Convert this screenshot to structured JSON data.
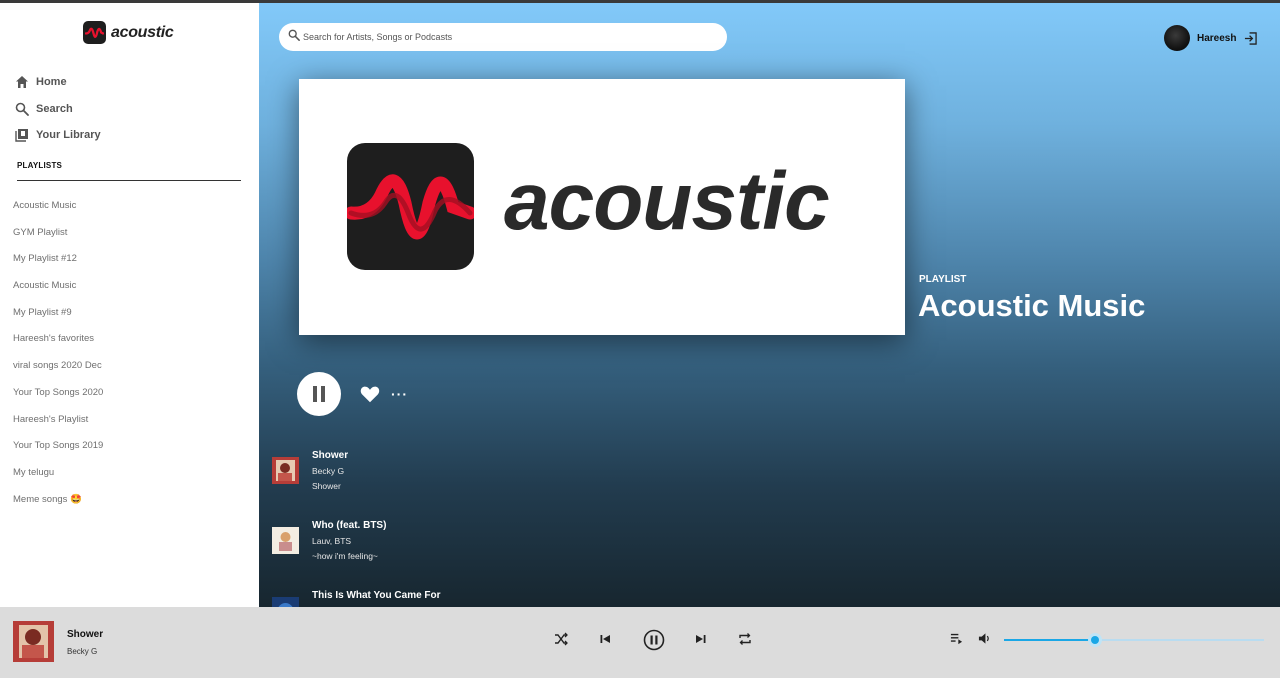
{
  "brand": {
    "name": "acoustic"
  },
  "nav": [
    {
      "label": "Home",
      "icon": "home-icon"
    },
    {
      "label": "Search",
      "icon": "search-icon"
    },
    {
      "label": "Your Library",
      "icon": "library-icon"
    }
  ],
  "playlists_heading": "PLAYLISTS",
  "playlists": [
    "Acoustic Music",
    "GYM Playlist",
    "My Playlist #12",
    "Acoustic Music",
    "My Playlist #9",
    "Hareesh's favorites",
    "viral songs 2020 Dec",
    "Your Top Songs 2020",
    "Hareesh's Playlist",
    "Your Top Songs 2019",
    "My telugu",
    "Meme songs 🤩"
  ],
  "search": {
    "placeholder": "Search for Artists, Songs or Podcasts"
  },
  "user": {
    "name": "Hareesh"
  },
  "cover": {
    "wordmark": "acoustic"
  },
  "playlist": {
    "type_label": "PLAYLIST",
    "title": "Acoustic Music"
  },
  "tracks": [
    {
      "title": "Shower",
      "artist": "Becky G",
      "album": "Shower"
    },
    {
      "title": "Who (feat. BTS)",
      "artist": "Lauv, BTS",
      "album": "~how i'm feeling~"
    },
    {
      "title": "This Is What You Came For",
      "artist": "",
      "album": ""
    }
  ],
  "now_playing": {
    "title": "Shower",
    "artist": "Becky G"
  },
  "volume": {
    "level": 0.35
  },
  "colors": {
    "accent": "#1aa7e6",
    "brand_red": "#e8112d",
    "sidebar_bg": "#ffffff",
    "player_bg": "#dcdcdc"
  }
}
